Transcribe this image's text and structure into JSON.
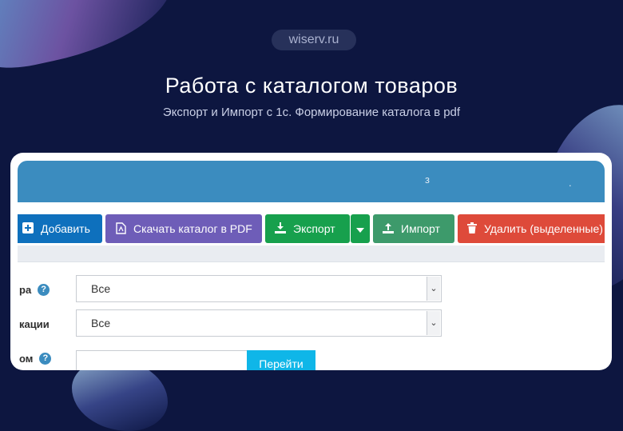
{
  "site": {
    "domain": "wiserv.ru"
  },
  "hero": {
    "title": "Работа с каталогом товаров",
    "subtitle": "Экспорт и Импорт с 1с. Формирование каталога в pdf"
  },
  "card": {
    "header_marks": [
      "з",
      "."
    ],
    "toolbar": {
      "add_label": "Добавить",
      "pdf_label": "Скачать каталог в PDF",
      "export_label": "Экспорт",
      "import_label": "Импорт",
      "delete_label": "Удалить (выделенные)"
    },
    "filters": [
      {
        "label": "ра",
        "value": "Все",
        "has_help": true
      },
      {
        "label": "кации",
        "value": "Все",
        "has_help": false
      }
    ],
    "search_row": {
      "label": "ом",
      "button_label": "Перейти"
    }
  },
  "icons": {
    "add": "plus-square-icon",
    "pdf": "pdf-file-icon",
    "export": "download-icon",
    "import": "upload-icon",
    "delete": "trash-icon",
    "help": "question-circle-icon"
  },
  "colors": {
    "page_bg": "#0d1640",
    "header": "#3b8cbf",
    "add": "#0e70bd",
    "pdf": "#6e5db8",
    "export": "#17a04d",
    "import": "#3d9a6b",
    "delete": "#de4a3a",
    "go": "#0fb6e8"
  }
}
